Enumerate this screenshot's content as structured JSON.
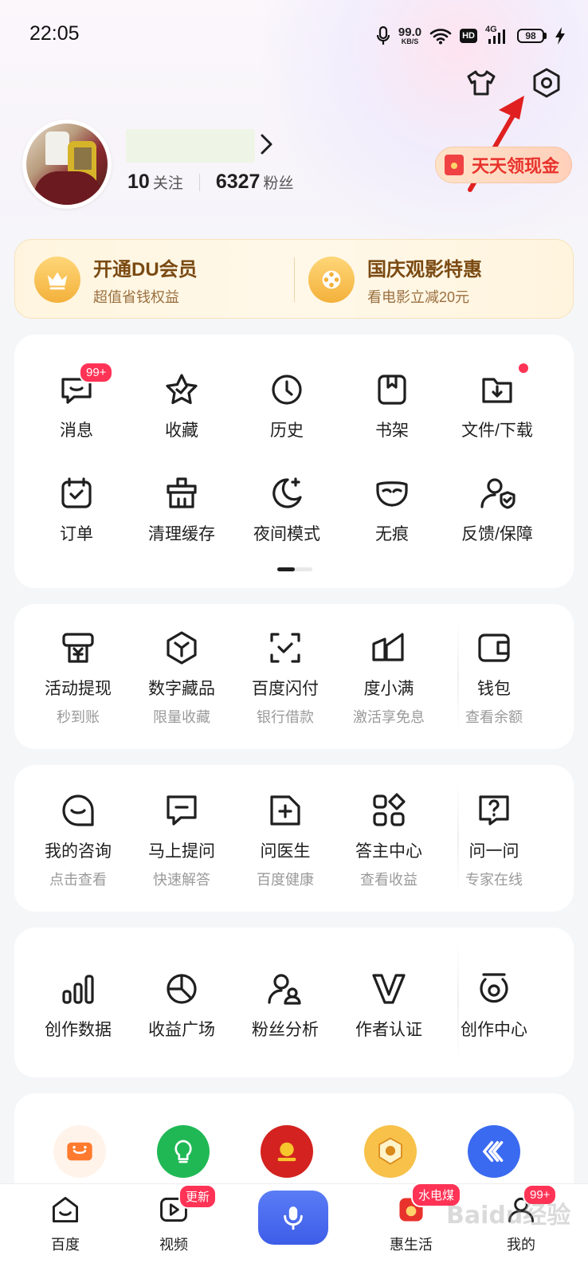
{
  "status_bar": {
    "time": "22:05",
    "net_speed_value": "99.0",
    "net_speed_unit": "KB/S",
    "hd": "HD",
    "network": "4G",
    "battery": "98"
  },
  "profile": {
    "following_count": "10",
    "following_label": "关注",
    "fans_count": "6327",
    "fans_label": "粉丝",
    "cash_button": "天天领现金"
  },
  "vip_banner": {
    "left_title": "开通DU会员",
    "left_sub": "超值省钱权益",
    "right_title": "国庆观影特惠",
    "right_sub": "看电影立减20元"
  },
  "tools": {
    "items": [
      {
        "label": "消息",
        "icon": "message-icon",
        "badge": "99+"
      },
      {
        "label": "收藏",
        "icon": "star-icon"
      },
      {
        "label": "历史",
        "icon": "clock-icon"
      },
      {
        "label": "书架",
        "icon": "bookshelf-icon"
      },
      {
        "label": "文件/下载",
        "icon": "download-folder-icon"
      },
      {
        "label": "订单",
        "icon": "order-icon"
      },
      {
        "label": "清理缓存",
        "icon": "clean-cache-icon"
      },
      {
        "label": "夜间模式",
        "icon": "moon-icon"
      },
      {
        "label": "无痕",
        "icon": "mask-icon"
      },
      {
        "label": "反馈/保障",
        "icon": "feedback-shield-icon"
      }
    ]
  },
  "finance": {
    "items": [
      {
        "label": "活动提现",
        "sub": "秒到账",
        "icon": "withdraw-icon"
      },
      {
        "label": "数字藏品",
        "sub": "限量收藏",
        "icon": "cube-icon"
      },
      {
        "label": "百度闪付",
        "sub": "银行借款",
        "icon": "scan-pay-icon"
      },
      {
        "label": "度小满",
        "sub": "激活享免息",
        "icon": "duxiaoman-icon"
      },
      {
        "label": "钱包",
        "sub": "查看余额",
        "icon": "wallet-icon"
      }
    ]
  },
  "consult": {
    "items": [
      {
        "label": "我的咨询",
        "sub": "点击查看",
        "icon": "consult-icon"
      },
      {
        "label": "马上提问",
        "sub": "快速解答",
        "icon": "ask-icon"
      },
      {
        "label": "问医生",
        "sub": "百度健康",
        "icon": "doctor-icon"
      },
      {
        "label": "答主中心",
        "sub": "查看收益",
        "icon": "apps-icon"
      },
      {
        "label": "问一问",
        "sub": "专家在线",
        "icon": "question-icon"
      }
    ]
  },
  "creator": {
    "items": [
      {
        "label": "创作数据",
        "icon": "bar-chart-icon"
      },
      {
        "label": "收益广场",
        "icon": "pie-chart-icon"
      },
      {
        "label": "粉丝分析",
        "icon": "fans-icon"
      },
      {
        "label": "作者认证",
        "icon": "verify-icon"
      },
      {
        "label": "创作中心",
        "icon": "creator-center-icon"
      }
    ]
  },
  "services": [
    "ticket-icon",
    "bulb-icon",
    "gov-service-icon",
    "badge-icon",
    "app-icon"
  ],
  "bottom_nav": {
    "items": [
      {
        "label": "百度",
        "icon": "home-icon"
      },
      {
        "label": "视频",
        "icon": "video-icon",
        "badge": "更新"
      },
      {
        "label": "",
        "icon": "mic-icon"
      },
      {
        "label": "惠生活",
        "icon": "life-icon",
        "badge": "水电煤"
      },
      {
        "label": "我的",
        "icon": "me-icon",
        "badge": "99+"
      }
    ]
  },
  "watermark": "Baidu经验",
  "colors": {
    "accent": "#3d5de8",
    "badge": "#ff3355",
    "cash_text": "#e8322c",
    "vip_gold": "#f3b13b",
    "annotation_arrow": "#e02020"
  }
}
